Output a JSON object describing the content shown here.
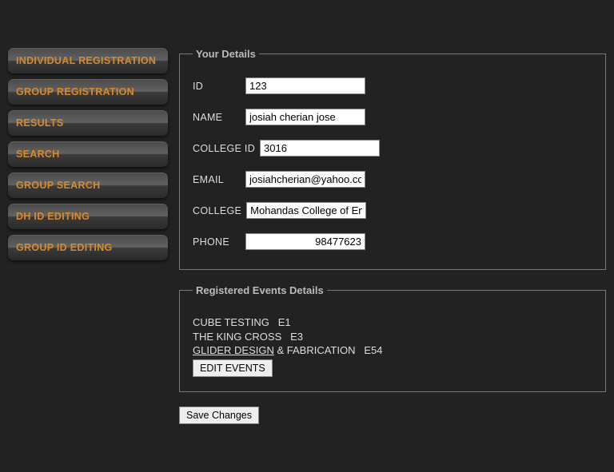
{
  "sidebar": {
    "items": [
      {
        "label": "INDIVIDUAL REGISTRATION"
      },
      {
        "label": "GROUP REGISTRATION"
      },
      {
        "label": "RESULTS"
      },
      {
        "label": "SEARCH"
      },
      {
        "label": "GROUP SEARCH"
      },
      {
        "label": "DH ID EDITING"
      },
      {
        "label": "GROUP ID EDITING"
      }
    ]
  },
  "details": {
    "legend": "Your Details",
    "id_label": "ID",
    "id_value": "123",
    "name_label": "NAME",
    "name_value": "josiah cherian jose",
    "college_id_label": "COLLEGE ID",
    "college_id_value": "3016",
    "email_label": "EMAIL",
    "email_value": "josiahcherian@yahoo.com",
    "college_label": "COLLEGE",
    "college_value": "Mohandas College of Eng",
    "phone_label": "PHONE",
    "phone_value": "98477623"
  },
  "events": {
    "legend": "Registered Events Details",
    "list": [
      {
        "name": "CUBE TESTING",
        "code": "E1"
      },
      {
        "name": "THE KING CROSS",
        "code": "E3"
      },
      {
        "name_u": "GLIDER DESIGN",
        "name_rest": " & FABRICATION",
        "code": "E54"
      }
    ],
    "edit_label": "EDIT EVENTS"
  },
  "actions": {
    "save_label": "Save Changes"
  }
}
